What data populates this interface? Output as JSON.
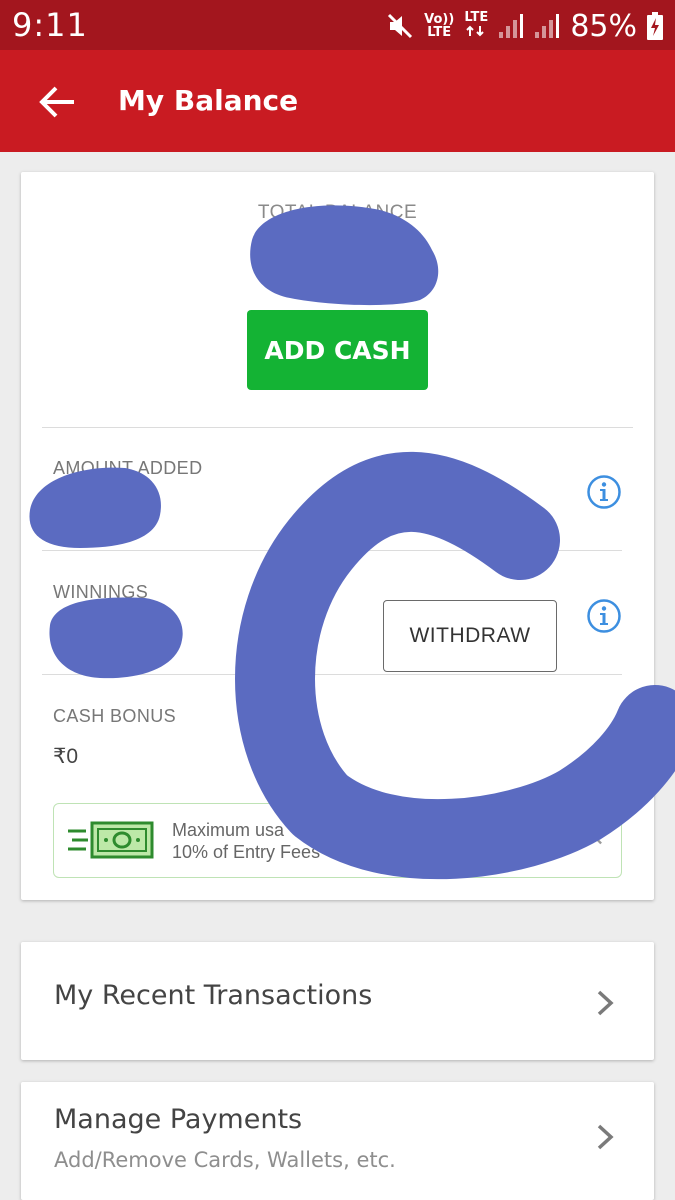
{
  "status_bar": {
    "time": "9:11",
    "volte_label_top": "Vo))",
    "volte_label_bottom": "LTE",
    "lte_label": "LTE",
    "battery_percent": "85%"
  },
  "app_bar": {
    "title": "My Balance"
  },
  "balance": {
    "total_label": "TOTAL BALANCE",
    "add_cash_label": "ADD CASH",
    "amount_added_label": "AMOUNT ADDED",
    "winnings_label": "WINNINGS",
    "withdraw_label": "WITHDRAW",
    "cash_bonus_label": "CASH BONUS",
    "cash_bonus_value": "₹0",
    "note_line1": "Maximum usa",
    "note_line2": "10% of Entry Fees"
  },
  "menu": {
    "transactions_label": "My Recent Transactions",
    "payments_label": "Manage Payments",
    "payments_sub": "Add/Remove Cards, Wallets, etc."
  },
  "colors": {
    "status_bar": "#a3161e",
    "app_bar": "#c91b22",
    "add_cash": "#14b334",
    "info_blue": "#3d8fe0",
    "scribble": "#5b6bc1"
  }
}
